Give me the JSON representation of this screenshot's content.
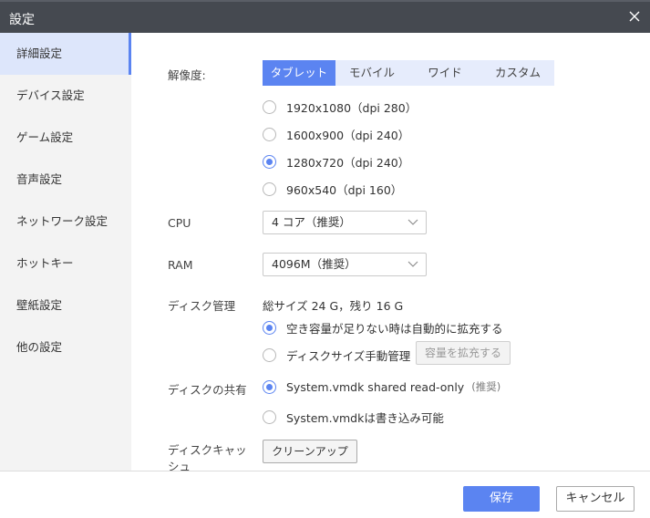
{
  "window": {
    "title": "設定"
  },
  "sidebar": {
    "items": [
      {
        "label": "詳細設定",
        "active": true
      },
      {
        "label": "デバイス設定"
      },
      {
        "label": "ゲーム設定"
      },
      {
        "label": "音声設定"
      },
      {
        "label": "ネットワーク設定"
      },
      {
        "label": "ホットキー"
      },
      {
        "label": "壁紙設定"
      },
      {
        "label": "他の設定"
      }
    ]
  },
  "resolution": {
    "label": "解像度:",
    "tabs": [
      {
        "label": "タブレット",
        "active": true
      },
      {
        "label": "モバイル"
      },
      {
        "label": "ワイド"
      },
      {
        "label": "カスタム"
      }
    ],
    "options": [
      {
        "label": "1920x1080（dpi 280）",
        "selected": false
      },
      {
        "label": "1600x900（dpi 240）",
        "selected": false
      },
      {
        "label": "1280x720（dpi 240）",
        "selected": true
      },
      {
        "label": "960x540（dpi 160）",
        "selected": false
      }
    ]
  },
  "cpu": {
    "label": "CPU",
    "value": "4 コア（推奨）"
  },
  "ram": {
    "label": "RAM",
    "value": "4096M（推奨）"
  },
  "disk": {
    "label": "ディスク管理",
    "summary": "総サイズ 24 G，残り 16 G",
    "options": [
      {
        "label": "空き容量が足りない時は自動的に拡充する",
        "selected": true
      },
      {
        "label": "ディスクサイズ手動管理",
        "selected": false
      }
    ],
    "expand_button": "容量を拡充する"
  },
  "share": {
    "label": "ディスクの共有",
    "options": [
      {
        "label": "System.vmdk shared read-only",
        "note": "(推奨)",
        "selected": true
      },
      {
        "label": "System.vmdkは書き込み可能",
        "selected": false
      }
    ]
  },
  "cache": {
    "label": "ディスクキャッシュ",
    "button": "クリーンアップ"
  },
  "footer": {
    "save": "保存",
    "cancel": "キャンセル"
  },
  "colors": {
    "accent": "#5b84f1",
    "titlebar": "#454950",
    "sidebar": "#f3f3f3"
  }
}
